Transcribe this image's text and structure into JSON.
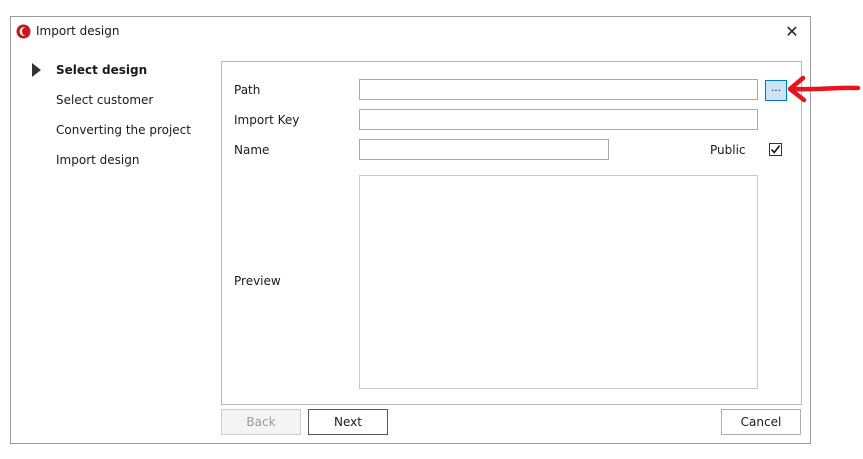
{
  "window": {
    "title": "Import design"
  },
  "steps": [
    {
      "label": "Select design",
      "active": true
    },
    {
      "label": "Select customer",
      "active": false
    },
    {
      "label": "Converting the project",
      "active": false
    },
    {
      "label": "Import design",
      "active": false
    }
  ],
  "form": {
    "path_label": "Path",
    "path_value": "",
    "browse_label": "...",
    "import_key_label": "Import Key",
    "import_key_value": "",
    "name_label": "Name",
    "name_value": "",
    "public_label": "Public",
    "public_checked": true,
    "preview_label": "Preview"
  },
  "buttons": {
    "back": "Back",
    "next": "Next",
    "cancel": "Cancel"
  },
  "annotation": {
    "arrow_color": "#e8141c"
  }
}
